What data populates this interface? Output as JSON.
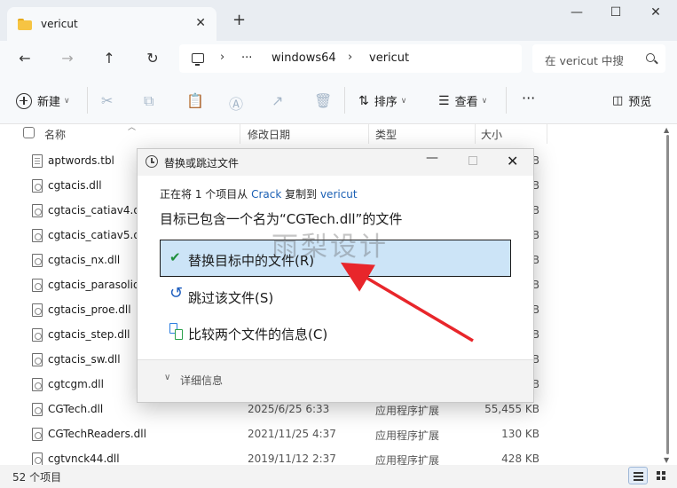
{
  "tabs": [
    {
      "title": "vericut"
    }
  ],
  "window": {
    "minimize": "—",
    "maximize": "☐",
    "close": "✕"
  },
  "address": {
    "crumbs": [
      "windows64",
      "vericut"
    ],
    "ellipsis": "···",
    "sep": "›",
    "search_placeholder": "在 vericut 中搜"
  },
  "toolbar": {
    "new_label": "新建",
    "sort_label": "排序",
    "view_label": "查看",
    "more_label": "···",
    "preview_label": "预览"
  },
  "columns": {
    "name": "名称",
    "modified": "修改日期",
    "type": "类型",
    "size": "大小"
  },
  "files": [
    {
      "name": "aptwords.tbl",
      "kind": "tbl",
      "date": "",
      "type": "",
      "size": "KB"
    },
    {
      "name": "cgtacis.dll",
      "kind": "dll",
      "date": "",
      "type": "",
      "size": "KB"
    },
    {
      "name": "cgtacis_catiav4.dll",
      "kind": "dll",
      "date": "",
      "type": "",
      "size": "KB"
    },
    {
      "name": "cgtacis_catiav5.dll",
      "kind": "dll",
      "date": "",
      "type": "",
      "size": "KB"
    },
    {
      "name": "cgtacis_nx.dll",
      "kind": "dll",
      "date": "",
      "type": "",
      "size": "KB"
    },
    {
      "name": "cgtacis_parasolid",
      "kind": "dll",
      "date": "",
      "type": "",
      "size": "KB"
    },
    {
      "name": "cgtacis_proe.dll",
      "kind": "dll",
      "date": "",
      "type": "",
      "size": "KB"
    },
    {
      "name": "cgtacis_step.dll",
      "kind": "dll",
      "date": "",
      "type": "",
      "size": "KB"
    },
    {
      "name": "cgtacis_sw.dll",
      "kind": "dll",
      "date": "",
      "type": "",
      "size": "KB"
    },
    {
      "name": "cgtcgm.dll",
      "kind": "dll",
      "date": "",
      "type": "",
      "size": "KB"
    },
    {
      "name": "CGTech.dll",
      "kind": "dll",
      "date": "2025/6/25 6:33",
      "type": "应用程序扩展",
      "size": "55,455 KB"
    },
    {
      "name": "CGTechReaders.dll",
      "kind": "dll",
      "date": "2021/11/25 4:37",
      "type": "应用程序扩展",
      "size": "130 KB"
    },
    {
      "name": "cgtvnck44.dll",
      "kind": "dll",
      "date": "2019/11/12 2:37",
      "type": "应用程序扩展",
      "size": "428 KB"
    }
  ],
  "status": {
    "count_text": "52 个项目"
  },
  "dialog": {
    "title": "替换或跳过文件",
    "line1_pre": "正在将 1 个项目从 ",
    "line1_src": "Crack",
    "line1_mid": " 复制到 ",
    "line1_dst": "vericut",
    "heading": "目标已包含一个名为“CGTech.dll”的文件",
    "options": [
      {
        "icon": "check-icon",
        "label": "替换目标中的文件(R)"
      },
      {
        "icon": "undo-icon",
        "label": "跳过该文件(S)"
      },
      {
        "icon": "compare-icon",
        "label": "比较两个文件的信息(C)"
      }
    ],
    "details_label": "详细信息",
    "details_chevron": "∨"
  },
  "watermark": "雨梨设计",
  "colors": {
    "accent": "#1a5fb4",
    "highlight": "#cce4f7",
    "arrow": "#e8262b"
  }
}
